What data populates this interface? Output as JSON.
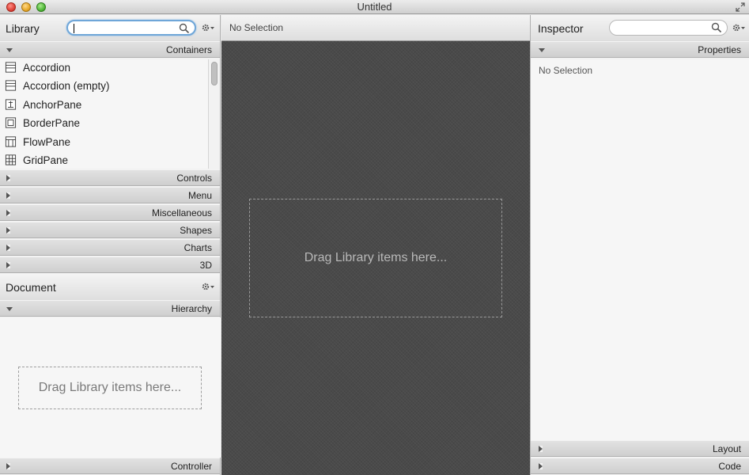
{
  "window": {
    "title": "Untitled"
  },
  "library": {
    "title": "Library",
    "search_value": "",
    "sections": {
      "containers": "Containers",
      "controls": "Controls",
      "menu": "Menu",
      "miscellaneous": "Miscellaneous",
      "shapes": "Shapes",
      "charts": "Charts",
      "three_d": "3D"
    },
    "items": [
      {
        "label": "Accordion",
        "icon": "accordion-icon"
      },
      {
        "label": "Accordion  (empty)",
        "icon": "accordion-icon"
      },
      {
        "label": "AnchorPane",
        "icon": "anchor-pane-icon"
      },
      {
        "label": "BorderPane",
        "icon": "border-pane-icon"
      },
      {
        "label": "FlowPane",
        "icon": "flow-pane-icon"
      },
      {
        "label": "GridPane",
        "icon": "grid-pane-icon"
      }
    ]
  },
  "document": {
    "title": "Document",
    "hierarchy_label": "Hierarchy",
    "drop_hint": "Drag Library items here...",
    "controller_label": "Controller"
  },
  "center": {
    "selection_label": "No Selection",
    "drop_hint": "Drag Library items here..."
  },
  "inspector": {
    "title": "Inspector",
    "properties_label": "Properties",
    "selection_label": "No Selection",
    "layout_label": "Layout",
    "code_label": "Code"
  }
}
